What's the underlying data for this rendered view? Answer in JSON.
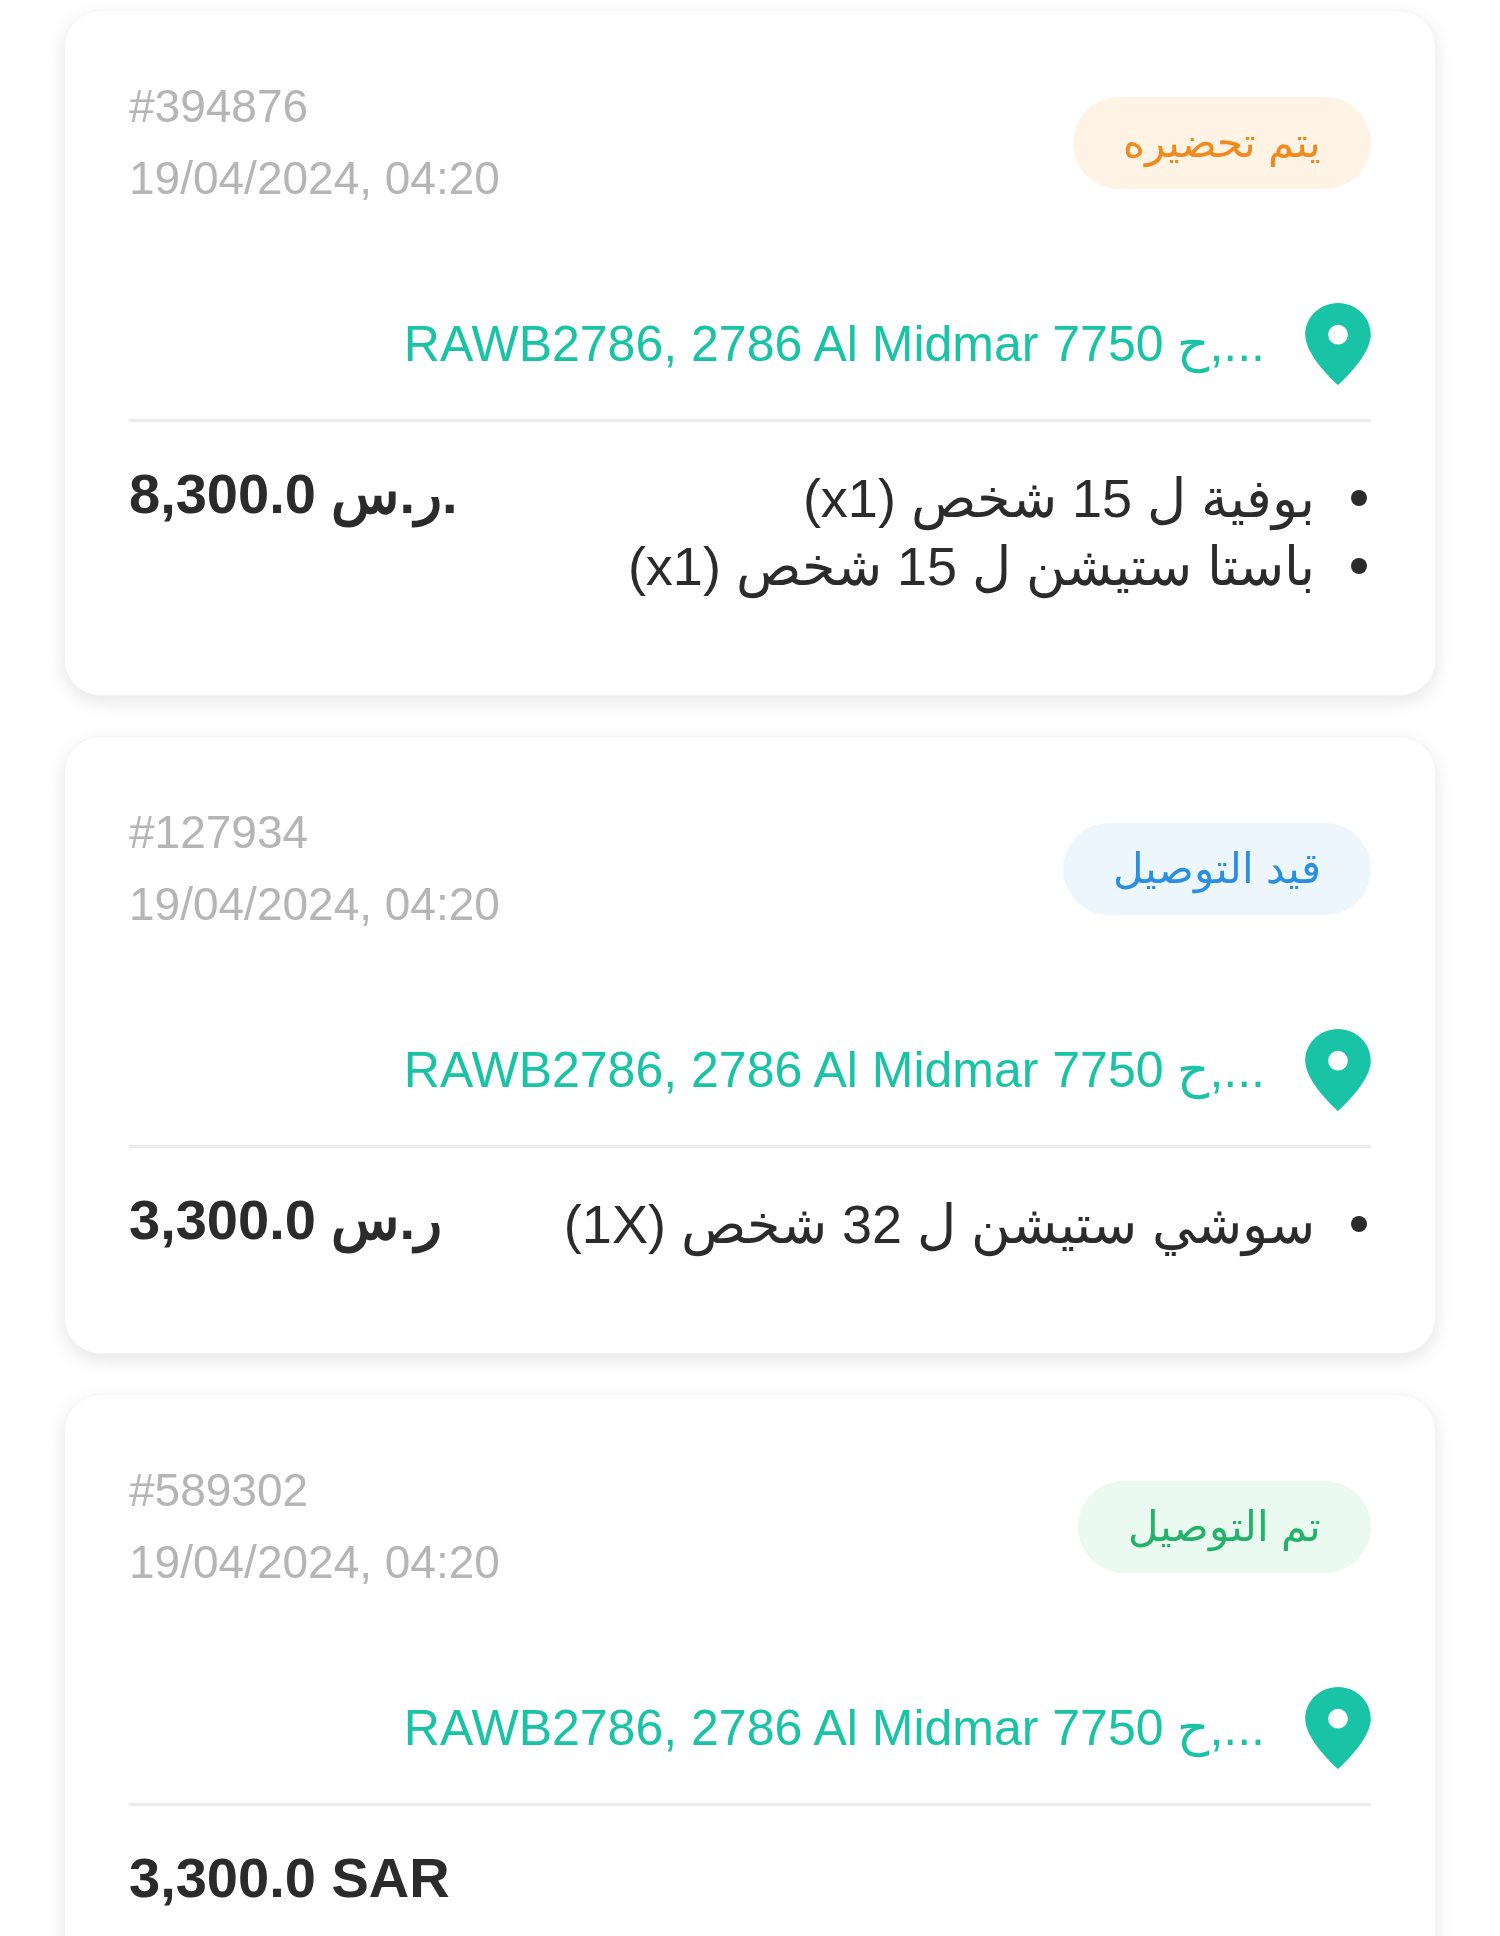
{
  "orders": [
    {
      "order_id": "#394876",
      "datetime": "19/04/2024, 04:20",
      "status": {
        "label": "يتم تحضيره",
        "kind": "preparing"
      },
      "address": "RAWB2786, 2786 Al Midmar 7750 ح,...",
      "items": [
        "بوفية ل 15 شخص (x1)",
        "باستا ستيشن ل 15 شخص (x1)"
      ],
      "total": "8,300.0 ر.س."
    },
    {
      "order_id": "#127934",
      "datetime": "19/04/2024, 04:20",
      "status": {
        "label": "قيد التوصيل",
        "kind": "delivering"
      },
      "address": "RAWB2786, 2786 Al Midmar 7750 ح,...",
      "items": [
        "سوشي ستيشن ل 32 شخص (1X)"
      ],
      "total": "3,300.0 ر.س"
    },
    {
      "order_id": "#589302",
      "datetime": "19/04/2024, 04:20",
      "status": {
        "label": "تم التوصيل",
        "kind": "delivered"
      },
      "address": "RAWB2786, 2786 Al Midmar 7750 ح,...",
      "total": "3,300.0 SAR"
    }
  ]
}
